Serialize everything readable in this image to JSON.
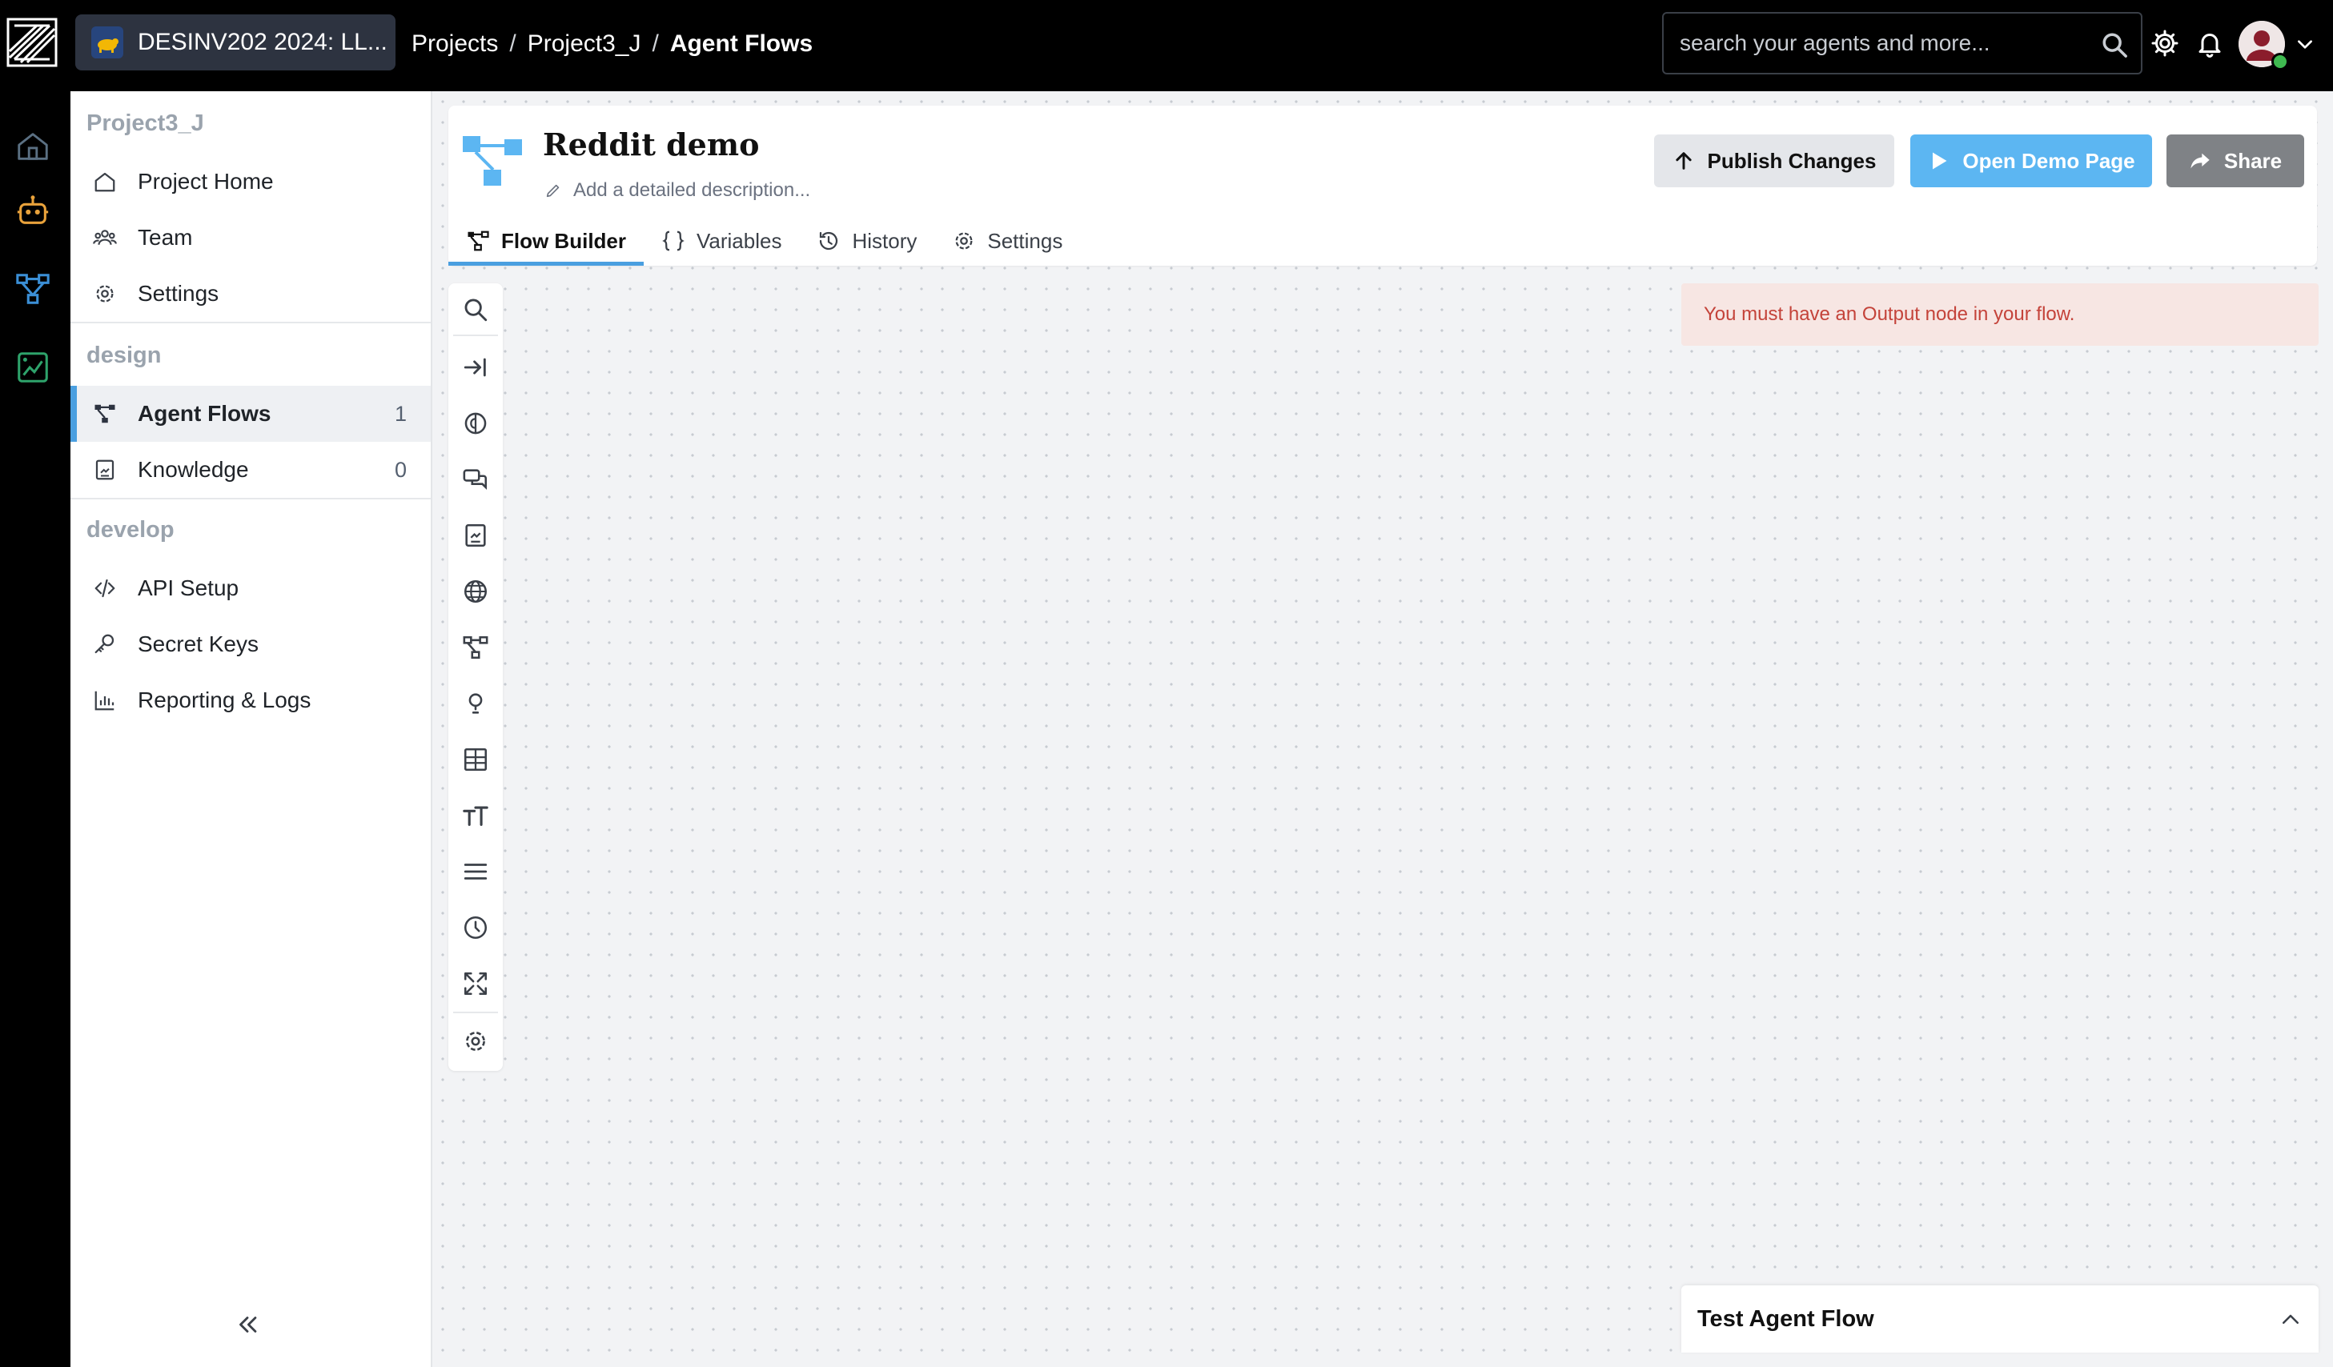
{
  "org": {
    "name": "DESINV202 2024: LL..."
  },
  "breadcrumb": {
    "projects": "Projects",
    "project": "Project3_J",
    "current": "Agent Flows",
    "separator": "/"
  },
  "search": {
    "placeholder": "search your agents and more..."
  },
  "sidebar": {
    "project_name": "Project3_J",
    "items": [
      {
        "label": "Project Home"
      },
      {
        "label": "Team"
      },
      {
        "label": "Settings"
      }
    ],
    "design": {
      "title": "design",
      "items": [
        {
          "label": "Agent Flows",
          "count": "1"
        },
        {
          "label": "Knowledge",
          "count": "0"
        }
      ]
    },
    "develop": {
      "title": "develop",
      "items": [
        {
          "label": "API Setup"
        },
        {
          "label": "Secret Keys"
        },
        {
          "label": "Reporting & Logs"
        }
      ]
    }
  },
  "flow": {
    "title": "Reddit demo",
    "description_placeholder": "Add a detailed description..."
  },
  "actions": {
    "publish": "Publish Changes",
    "demo": "Open Demo Page",
    "share": "Share"
  },
  "tabs": [
    {
      "label": "Flow Builder"
    },
    {
      "label": "Variables"
    },
    {
      "label": "History"
    },
    {
      "label": "Settings"
    }
  ],
  "alert": {
    "message": "You must have an Output node in your flow."
  },
  "test_panel": {
    "title": "Test Agent Flow"
  },
  "colors": {
    "accent": "#4a9fe0",
    "demo_button": "#5cb6f2",
    "share_button": "#7f8286",
    "alert_bg": "#f7e6e3",
    "alert_text": "#c4433a"
  },
  "icons": {
    "toolbox": [
      "search-icon",
      "input-icon",
      "llm-icon",
      "chat-icon",
      "knowledge-icon",
      "web-icon",
      "flow-icon",
      "question-icon",
      "table-icon",
      "text-icon",
      "list-icon",
      "clock-icon",
      "fit-view-icon",
      "gear-icon"
    ]
  }
}
